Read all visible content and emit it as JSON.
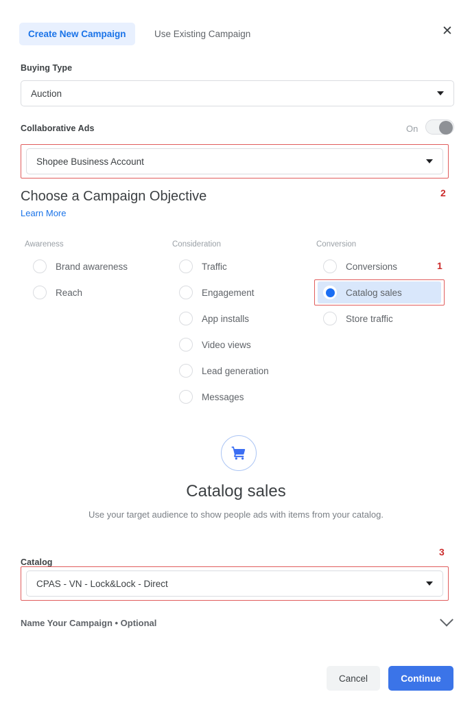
{
  "header": {
    "tab_active": "Create New Campaign",
    "tab_inactive": "Use Existing Campaign",
    "close_icon": "close-icon"
  },
  "buying_type": {
    "label": "Buying Type",
    "value": "Auction"
  },
  "collaborative_ads": {
    "label": "Collaborative Ads",
    "toggle_state": "On",
    "account_value": "Shopee Business Account"
  },
  "objective": {
    "title": "Choose a Campaign Objective",
    "learn_more": "Learn More",
    "columns": [
      {
        "heading": "Awareness",
        "options": [
          {
            "label": "Brand awareness",
            "selected": false
          },
          {
            "label": "Reach",
            "selected": false
          }
        ]
      },
      {
        "heading": "Consideration",
        "options": [
          {
            "label": "Traffic",
            "selected": false
          },
          {
            "label": "Engagement",
            "selected": false
          },
          {
            "label": "App installs",
            "selected": false
          },
          {
            "label": "Video views",
            "selected": false
          },
          {
            "label": "Lead generation",
            "selected": false
          },
          {
            "label": "Messages",
            "selected": false
          }
        ]
      },
      {
        "heading": "Conversion",
        "options": [
          {
            "label": "Conversions",
            "selected": false
          },
          {
            "label": "Catalog sales",
            "selected": true
          },
          {
            "label": "Store traffic",
            "selected": false
          }
        ]
      }
    ]
  },
  "hero": {
    "icon": "shopping-cart-icon",
    "title": "Catalog sales",
    "description": "Use your target audience to show people ads with items from your catalog."
  },
  "catalog": {
    "label": "Catalog",
    "value": "CPAS - VN - Lock&Lock - Direct"
  },
  "campaign_name": {
    "title": "Name Your Campaign • Optional",
    "chevron": "chevron-down-icon"
  },
  "footer": {
    "cancel": "Cancel",
    "continue": "Continue"
  },
  "annotations": {
    "one": "1",
    "two": "2",
    "three": "3"
  },
  "colors": {
    "accent_blue": "#1a73e8",
    "primary_button": "#3b74e8",
    "annotation_red": "#cc2b2b",
    "highlight_box": "#e05c5c",
    "selected_row": "#d9e7fb"
  }
}
